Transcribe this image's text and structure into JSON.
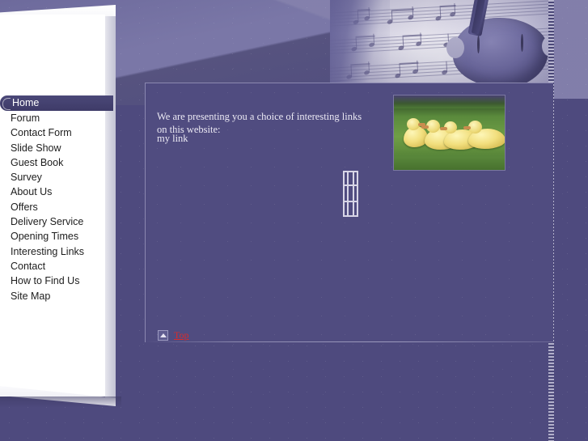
{
  "site": {
    "theme_colors": {
      "background": "#4e4a7e",
      "content_panel": "#504c80",
      "panel_white": "#ffffff",
      "active_nav": "#4b4878",
      "link_red": "#d92b2b",
      "banner_light": "#e4e2ee"
    }
  },
  "banner": {
    "image_alt": "violin-and-sheet-music"
  },
  "sidebar": {
    "items": [
      {
        "label": "Home",
        "active": true
      },
      {
        "label": "Forum",
        "active": false
      },
      {
        "label": "Contact Form",
        "active": false
      },
      {
        "label": "Slide Show",
        "active": false
      },
      {
        "label": "Guest Book",
        "active": false
      },
      {
        "label": "Survey",
        "active": false
      },
      {
        "label": "About Us",
        "active": false
      },
      {
        "label": "Offers",
        "active": false
      },
      {
        "label": "Delivery Service",
        "active": false
      },
      {
        "label": "Opening Times",
        "active": false
      },
      {
        "label": "Interesting Links",
        "active": false
      },
      {
        "label": "Contact",
        "active": false
      },
      {
        "label": "How to Find Us",
        "active": false
      },
      {
        "label": "Site Map",
        "active": false
      }
    ]
  },
  "main": {
    "intro_text": "We are presenting you a choice of interesting links on this website:",
    "link_label": "my link",
    "photo_alt": "four-yellow-ducklings-on-grass",
    "broken_image_alt": "broken-image-placeholder"
  },
  "footer": {
    "top_label": "Top",
    "top_icon": "up-arrow-icon"
  }
}
